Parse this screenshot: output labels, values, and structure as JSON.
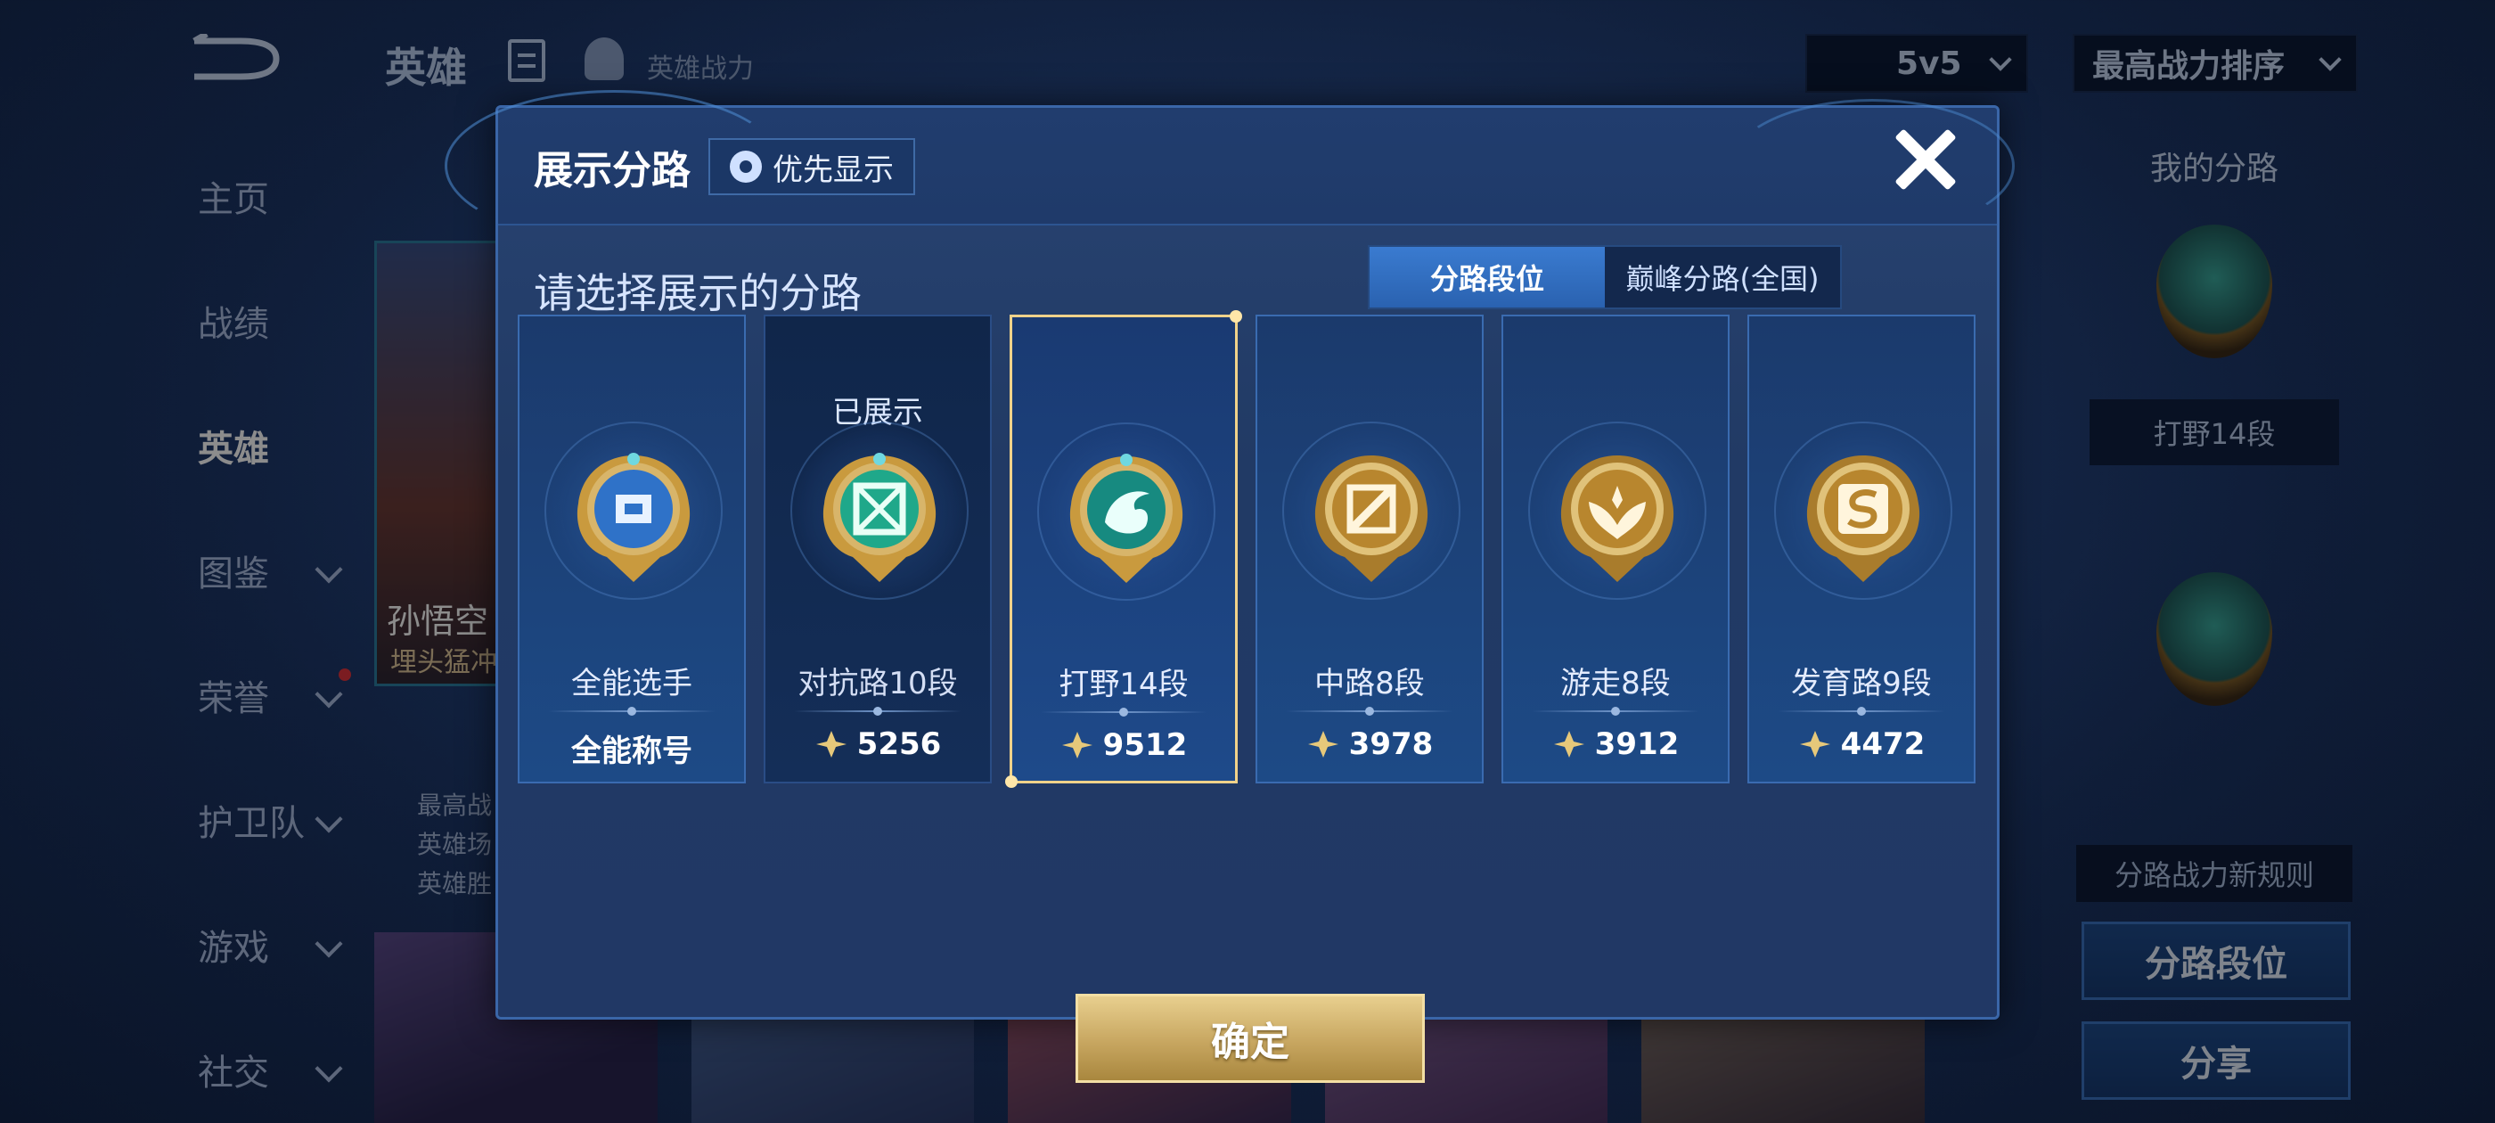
{
  "header": {
    "title": "英雄",
    "power_label": "英雄战力",
    "mode_select": "5v5",
    "sort_select": "最高战力排序"
  },
  "sidebar": {
    "items": [
      {
        "label": "主页",
        "expandable": false,
        "active": false
      },
      {
        "label": "战绩",
        "expandable": false,
        "active": false
      },
      {
        "label": "英雄",
        "expandable": false,
        "active": true
      },
      {
        "label": "图鉴",
        "expandable": true,
        "active": false
      },
      {
        "label": "荣誉",
        "expandable": true,
        "active": false,
        "notification": true
      },
      {
        "label": "护卫队",
        "expandable": true,
        "active": false
      },
      {
        "label": "游戏",
        "expandable": true,
        "active": false
      },
      {
        "label": "社交",
        "expandable": true,
        "active": false
      }
    ]
  },
  "hero": {
    "name": "孙悟空",
    "subtitle": "埋头猛冲",
    "stats": [
      "最高战",
      "英雄场",
      "英雄胜"
    ]
  },
  "right_panel": {
    "title": "我的分路",
    "lane_label": "打野14段",
    "rule_label": "分路战力新规则",
    "lane_rank_button": "分路段位",
    "share_button": "分享"
  },
  "modal": {
    "title": "展示分路",
    "priority_button": "优先显示",
    "prompt": "请选择展示的分路",
    "tabs": [
      {
        "label": "分路段位",
        "active": true
      },
      {
        "label": "巅峰分路(全国)",
        "active": false
      }
    ],
    "cards": [
      {
        "rank": "全能选手",
        "bottom": "全能称号",
        "shown_label": "",
        "state": "normal",
        "badge": "allround-badge-icon",
        "badge_color": "#3a7fd0"
      },
      {
        "rank": "对抗路10段",
        "bottom": "5256",
        "shown_label": "已展示",
        "state": "dim",
        "badge": "clash-lane-badge-icon",
        "badge_color": "#2aa88a"
      },
      {
        "rank": "打野14段",
        "bottom": "9512",
        "shown_label": "",
        "state": "selected",
        "badge": "jungle-badge-icon",
        "badge_color": "#1f8f86"
      },
      {
        "rank": "中路8段",
        "bottom": "3978",
        "shown_label": "",
        "state": "normal",
        "badge": "mid-lane-badge-icon",
        "badge_color": "#c99a3e"
      },
      {
        "rank": "游走8段",
        "bottom": "3912",
        "shown_label": "",
        "state": "normal",
        "badge": "roam-badge-icon",
        "badge_color": "#c99a3e"
      },
      {
        "rank": "发育路9段",
        "bottom": "4472",
        "shown_label": "",
        "state": "normal",
        "badge": "farm-lane-badge-icon",
        "badge_color": "#c99a3e"
      }
    ],
    "confirm_button": "确定",
    "colors": {
      "accent_gold": "#f0d28a",
      "active_tab": "#3a7bd0"
    }
  }
}
